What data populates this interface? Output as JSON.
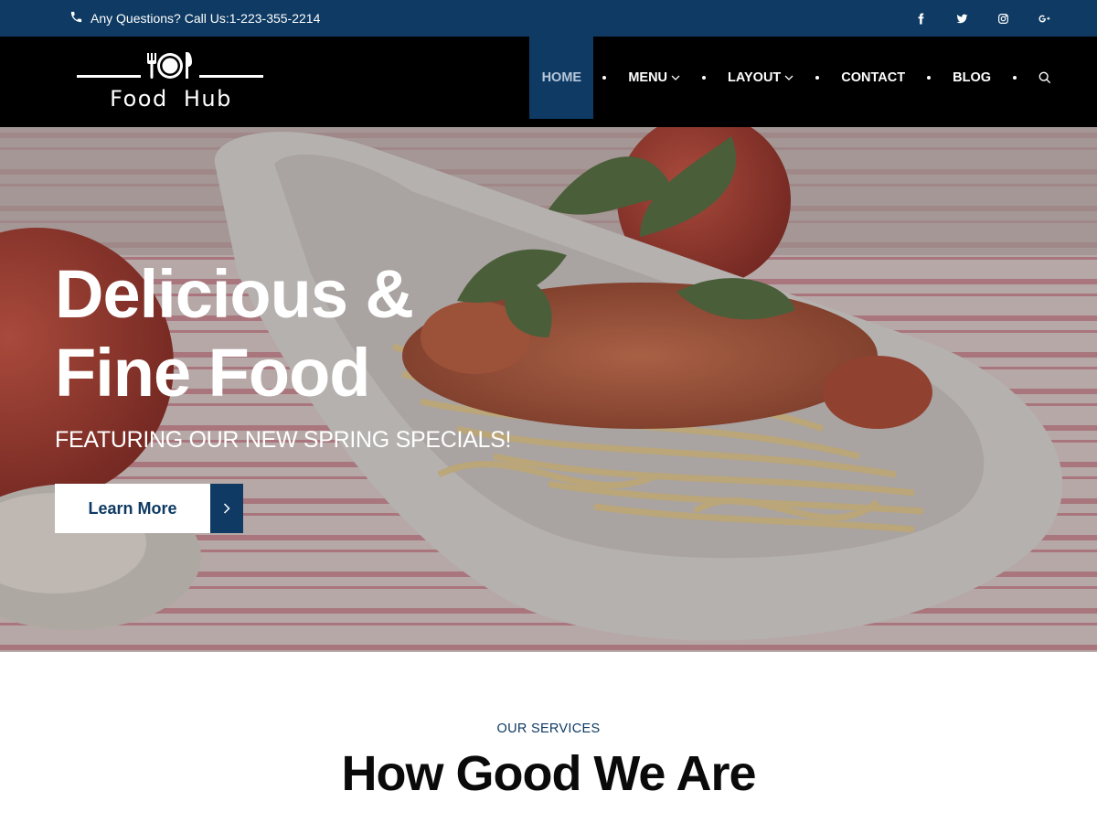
{
  "topbar": {
    "phone_icon": "phone-icon",
    "phone_text": "Any Questions? Call Us:1-223-355-2214",
    "socials": [
      "facebook-icon",
      "twitter-icon",
      "instagram-icon",
      "google-plus-icon"
    ]
  },
  "header": {
    "logo_text": "Food Hub",
    "nav": {
      "home": "HOME",
      "menu": "MENU",
      "layout": "LAYOUT",
      "contact": "CONTACT",
      "blog": "BLOG"
    }
  },
  "hero": {
    "title_line1": "Delicious &",
    "title_line2": "Fine Food",
    "subtitle": "FEATURING OUR NEW SPRING SPECIALS!",
    "button_label": "Learn More"
  },
  "services": {
    "kicker": "OUR SERVICES",
    "title": "How Good We Are"
  },
  "colors": {
    "brand_blue": "#0e3a63",
    "header_black": "#000000",
    "white": "#ffffff"
  }
}
